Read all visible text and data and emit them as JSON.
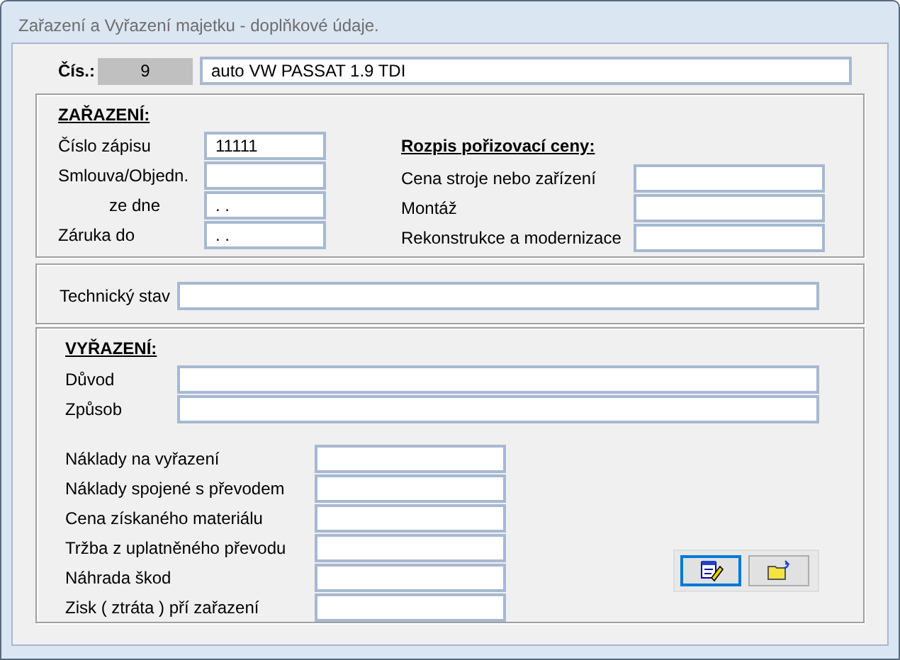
{
  "window": {
    "title": "Zařazení a Vyřazení majetku - doplňkové údaje."
  },
  "header": {
    "label": "Čís.:",
    "number": "9",
    "name": "auto VW PASSAT 1.9 TDI"
  },
  "zarazeni": {
    "heading": "ZAŘAZENÍ:",
    "fields": [
      {
        "label": "Číslo zápisu",
        "value": "11111",
        "kind": "plain"
      },
      {
        "label": "Smlouva/Objedn.",
        "kind": "plain"
      },
      {
        "label": "ze dne",
        "value": ". .",
        "kind": "sub"
      },
      {
        "label": "Záruka do",
        "value": ". .",
        "kind": "plain"
      }
    ],
    "price_breakdown": {
      "heading": "Rozpis pořizovací ceny:",
      "fields": [
        {
          "label": "Cena stroje nebo zařízení"
        },
        {
          "label": "Montáž"
        },
        {
          "label": "Rekonstrukce a modernizace"
        }
      ]
    }
  },
  "technical": {
    "label": "Technický stav"
  },
  "vyrazeni": {
    "heading": "VYŘAZENÍ:",
    "reason_fields": [
      {
        "label": "Důvod"
      },
      {
        "label": "Způsob"
      }
    ],
    "amount_fields": [
      {
        "label": "Náklady na vyřazení"
      },
      {
        "label": "Náklady spojené s převodem"
      },
      {
        "label": "Cena získaného materiálu"
      },
      {
        "label": "Tržba z uplatněného převodu"
      },
      {
        "label": "Náhrada škod"
      },
      {
        "label": "Zisk ( ztráta ) pří zařazení"
      }
    ]
  },
  "buttons": [
    {
      "kind": "edit",
      "focused": true
    },
    {
      "kind": "folder",
      "focused": false
    }
  ]
}
